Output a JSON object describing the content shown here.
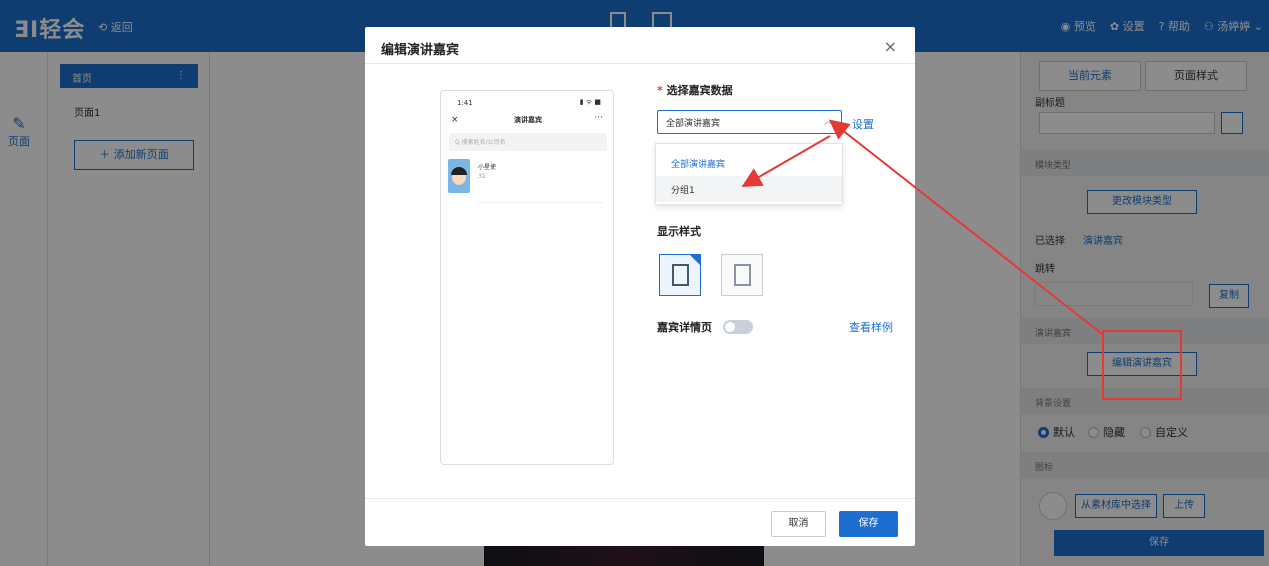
{
  "topbar": {
    "logo": "ƎI轻会",
    "back": "⟲ 返回",
    "preview": "◉ 预览",
    "settings": "✿ 设置",
    "help": "? 帮助",
    "user": "⚇ 汤婷婷 ⌄"
  },
  "leftrail": {
    "page_icon": "✎",
    "page_label": "页面"
  },
  "pages": {
    "home": "首页",
    "menu": "⋮",
    "item": "页面1",
    "add": "＋ 添加新页面"
  },
  "right": {
    "tab_current": "当前元素",
    "tab_style": "页面样式",
    "subtitle": "副标题",
    "module_type": "模块类型",
    "change_module": "更改模块类型",
    "selected_label": "已选择",
    "selected_value": "演讲嘉宾",
    "jump": "跳转",
    "copy": "复制",
    "speakers": "演讲嘉宾",
    "edit_speakers": "编辑演讲嘉宾",
    "bg": "背景设置",
    "r_default": "默认",
    "r_hide": "隐藏",
    "r_custom": "自定义",
    "icon": "图标",
    "pick_material": "从素材库中选择",
    "upload": "上传",
    "save": "保存"
  },
  "modal": {
    "title": "编辑演讲嘉宾",
    "close": "×",
    "phone": {
      "time": "1:41",
      "signal": "▮ ᯤ ■",
      "x": "×",
      "title": "演讲嘉宾",
      "more": "···",
      "search": "Q 搜索姓名/公司名",
      "name": "小星使",
      "sub": "31"
    },
    "req": "*",
    "data_label": "选择嘉宾数据",
    "select_value": "全部演讲嘉宾",
    "select_arrow": "︿",
    "set_link": "设置",
    "options": [
      "全部演讲嘉宾",
      "分组1"
    ],
    "style_label": "显示样式",
    "detail_label": "嘉宾详情页",
    "view_sample": "查看样例",
    "cancel": "取消",
    "save": "保存"
  },
  "colors": {
    "brand": "#1c6fd0",
    "annotation": "#e53935"
  }
}
